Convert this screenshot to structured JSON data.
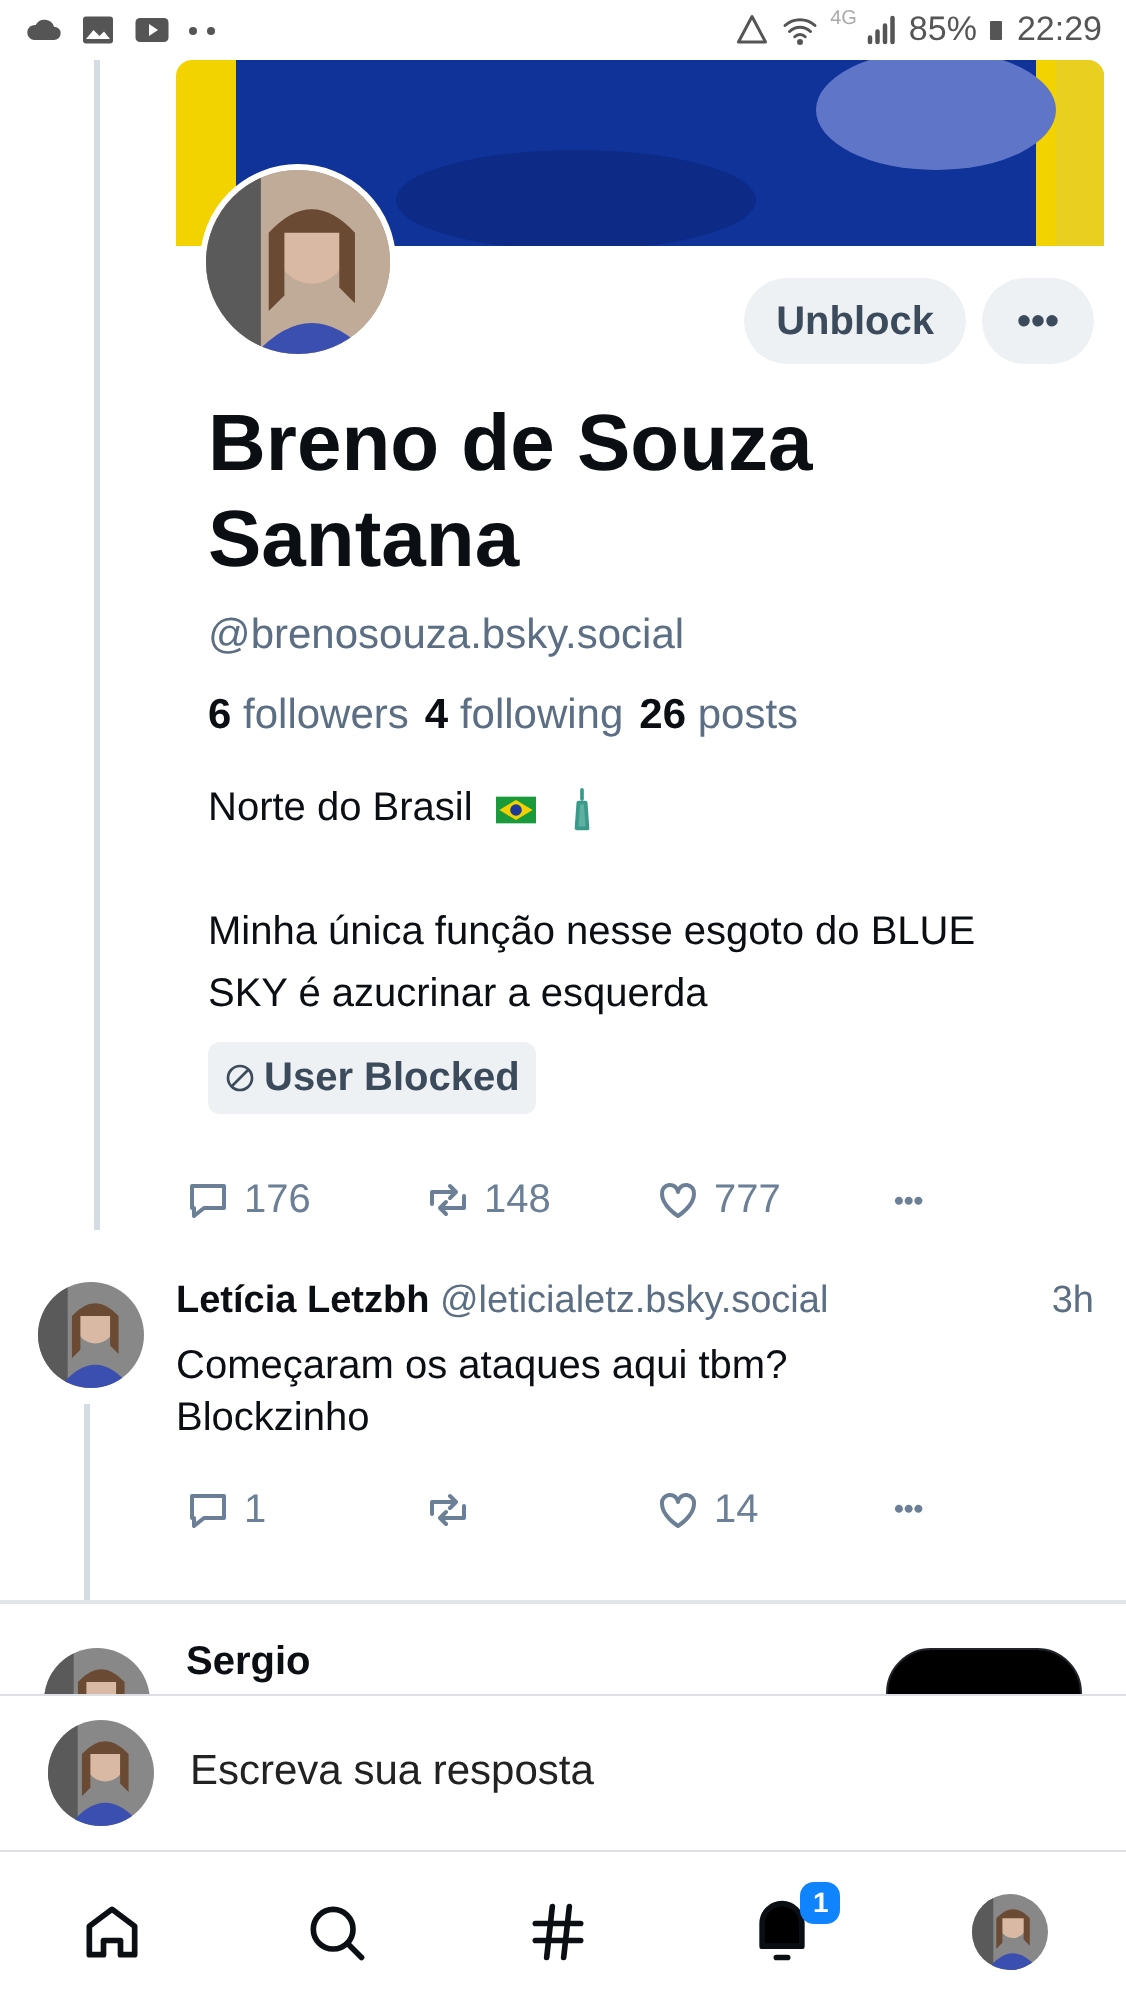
{
  "status_bar": {
    "battery": "85%",
    "time": "22:29",
    "network": "4G"
  },
  "profile": {
    "name": "Breno de Souza Santana",
    "handle": "@brenosouza.bsky.social",
    "stats": [
      {
        "count": "6",
        "label": "followers"
      },
      {
        "count": "4",
        "label": "following"
      },
      {
        "count": "26",
        "label": "posts"
      }
    ],
    "bio": [
      "Norte do Brasil",
      "Minha única função nesse esgoto do BLUE SKY é azucrinar a esquerda"
    ],
    "buttons": [
      "Unblock",
      "•••"
    ],
    "badge": "User Blocked",
    "actions": {
      "replies": "176",
      "reposts": "148",
      "likes": "777",
      "more": "•••"
    }
  },
  "reply": {
    "author": "Letícia Letzbh",
    "handle": "@leticialetz.bsky.social",
    "time": "3h",
    "text": "Começaram os ataques aqui tbm? Blockzinho",
    "actions": {
      "replies": "1",
      "likes": "14",
      "more": "•••"
    }
  },
  "next_post": {
    "author": "Sergio"
  },
  "composer": {
    "placeholder": "Escreva sua resposta"
  },
  "nav": [
    {
      "kind": "home"
    },
    {
      "kind": "search"
    },
    {
      "kind": "feeds"
    },
    {
      "kind": "notifications",
      "badge": "1"
    },
    {
      "kind": "profile"
    }
  ]
}
